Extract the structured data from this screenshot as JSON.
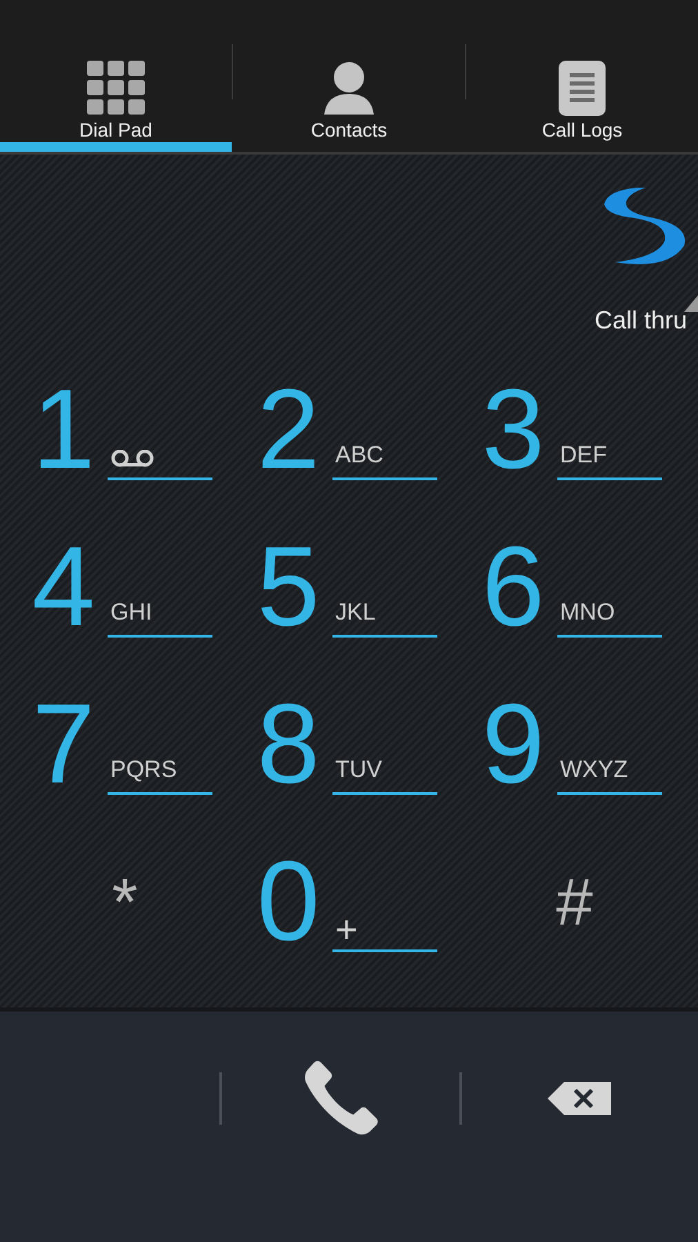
{
  "tabs": [
    {
      "label": "Dial Pad",
      "kind": "grid",
      "selected": true
    },
    {
      "label": "Contacts",
      "kind": "person",
      "selected": false
    },
    {
      "label": "Call Logs",
      "kind": "list",
      "selected": false
    }
  ],
  "account": {
    "label": "Call thru"
  },
  "keys": [
    {
      "kind": "voicemail",
      "digit": "1"
    },
    {
      "kind": "letters",
      "digit": "2",
      "letters": "ABC"
    },
    {
      "kind": "letters",
      "digit": "3",
      "letters": "DEF"
    },
    {
      "kind": "letters",
      "digit": "4",
      "letters": "GHI"
    },
    {
      "kind": "letters",
      "digit": "5",
      "letters": "JKL"
    },
    {
      "kind": "letters",
      "digit": "6",
      "letters": "MNO"
    },
    {
      "kind": "letters",
      "digit": "7",
      "letters": "PQRS"
    },
    {
      "kind": "letters",
      "digit": "8",
      "letters": "TUV"
    },
    {
      "kind": "letters",
      "digit": "9",
      "letters": "WXYZ"
    },
    {
      "kind": "symbol",
      "digit": "*"
    },
    {
      "kind": "letters",
      "digit": "0",
      "letters": "+"
    },
    {
      "kind": "symbol",
      "digit": "#"
    }
  ]
}
